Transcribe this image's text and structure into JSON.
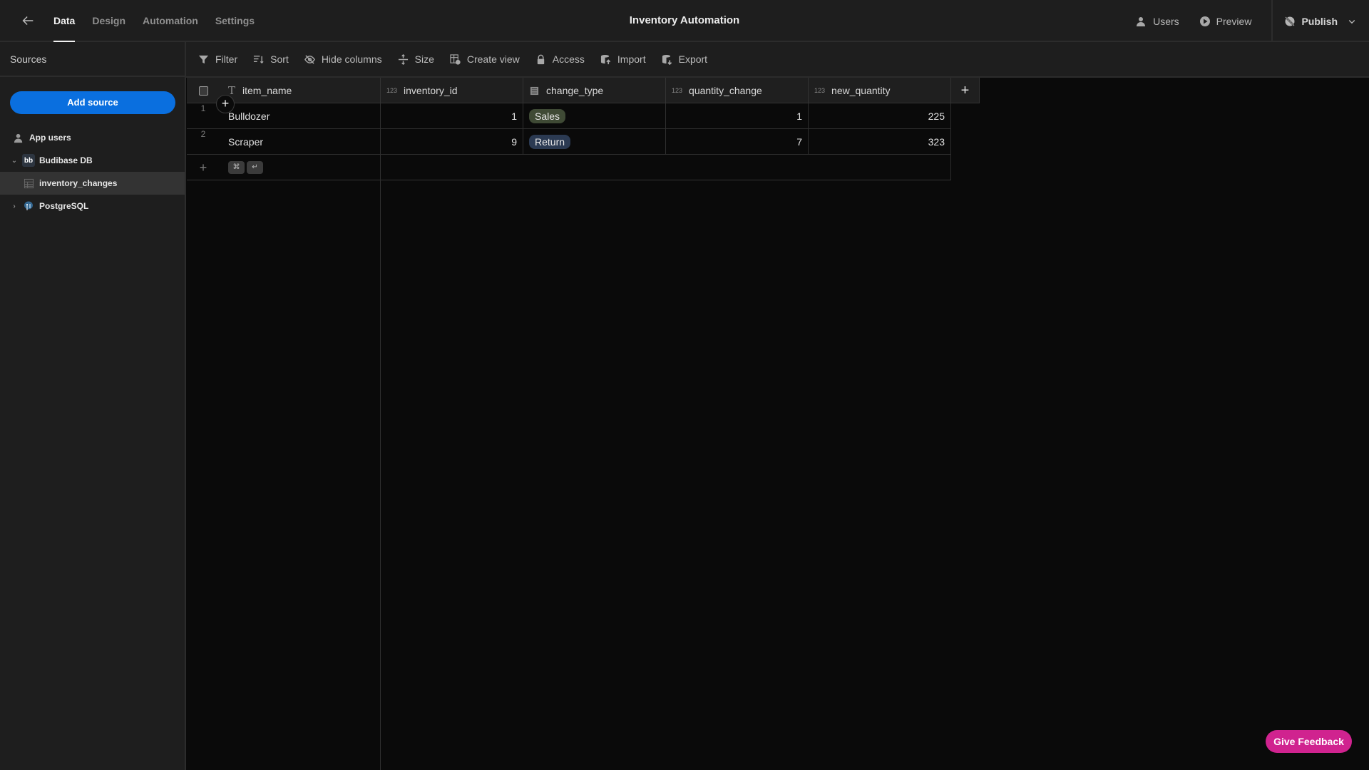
{
  "header": {
    "tabs": [
      {
        "label": "Data",
        "active": true
      },
      {
        "label": "Design",
        "active": false
      },
      {
        "label": "Automation",
        "active": false
      },
      {
        "label": "Settings",
        "active": false
      }
    ],
    "app_title": "Inventory Automation",
    "users_label": "Users",
    "preview_label": "Preview",
    "publish_label": "Publish"
  },
  "sidebar": {
    "title": "Sources",
    "add_source_label": "Add source",
    "items": [
      {
        "label": "App users",
        "icon": "users-icon"
      },
      {
        "label": "Budibase DB",
        "icon": "budibase-logo-icon",
        "expanded": true
      },
      {
        "label": "inventory_changes",
        "icon": "table-icon",
        "selected": true
      },
      {
        "label": "PostgreSQL",
        "icon": "postgresql-icon",
        "expanded": false
      }
    ]
  },
  "toolbar": {
    "filter": "Filter",
    "sort": "Sort",
    "hide_columns": "Hide columns",
    "size": "Size",
    "create_view": "Create view",
    "access": "Access",
    "import": "Import",
    "export": "Export"
  },
  "table": {
    "columns": [
      {
        "name": "item_name",
        "type": "text",
        "type_glyph": "T"
      },
      {
        "name": "inventory_id",
        "type": "number",
        "type_glyph": "123"
      },
      {
        "name": "change_type",
        "type": "options",
        "type_glyph": "options"
      },
      {
        "name": "quantity_change",
        "type": "number",
        "type_glyph": "123"
      },
      {
        "name": "new_quantity",
        "type": "number",
        "type_glyph": "123"
      }
    ],
    "rows": [
      {
        "num": "1",
        "item_name": "Bulldozer",
        "inventory_id": "1",
        "change_type": "Sales",
        "quantity_change": "1",
        "new_quantity": "225"
      },
      {
        "num": "2",
        "item_name": "Scraper",
        "inventory_id": "9",
        "change_type": "Return",
        "quantity_change": "7",
        "new_quantity": "323"
      }
    ],
    "shortcut_keys": [
      "⌘",
      "↵"
    ],
    "pill_colors": {
      "Sales": "#3f4a35",
      "Return": "#2b3a52"
    }
  },
  "feedback_label": "Give Feedback"
}
